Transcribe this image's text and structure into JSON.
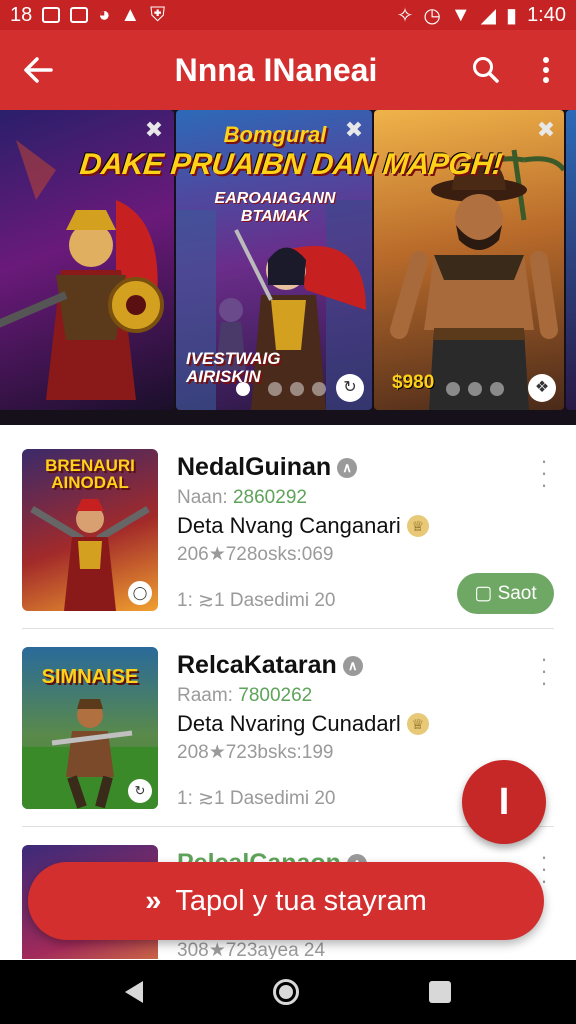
{
  "status_bar": {
    "time_left": "18",
    "clock": "1:40"
  },
  "app_bar": {
    "title": "Nnna INaneai"
  },
  "carousel": {
    "banner_superhead": "Bomgural",
    "headline": "DAKE PRUAIBN DAN MAPGH!",
    "subhead": "EAROAIAGANN BTAMAK",
    "tag": "IVESTWAIG\nAIRISKIN",
    "price": "$980",
    "page_indicator": {
      "current": 1,
      "total": 4
    }
  },
  "games": [
    {
      "name": "NedalGuinan",
      "thumb_label": "BRENAURI AINODAL",
      "id_label": "Naan:",
      "id_value": "2860292",
      "subtitle": "Deta Nvang Canganari",
      "stats": "206★728osks:069",
      "info": "1: ≳1 Dasedimi 20",
      "action_label": "Saot",
      "thumb_colors": [
        "#3a2a6a",
        "#a22a2a",
        "#f0a030"
      ]
    },
    {
      "name": "RelcaKataran",
      "thumb_label": "SIMNAISE",
      "id_label": "Raam:",
      "id_value": "7800262",
      "subtitle": "Deta Nvaring Cunadarl",
      "stats": "208★723bsks:199",
      "info": "1: ≳1 Dasedimi 20",
      "action_label": "",
      "thumb_colors": [
        "#2a6a9a",
        "#3a7a2a",
        "#c88a3a"
      ]
    },
    {
      "name": "PelcalCanaon",
      "thumb_label": "",
      "id_label": "",
      "id_value": "",
      "subtitle": "",
      "stats": "308★723ayea 24",
      "info": "",
      "action_label": "",
      "thumb_colors": [
        "#3a2a7a",
        "#a22a5a",
        "#f0a030"
      ]
    }
  ],
  "fab": {
    "label": "I"
  },
  "cta": {
    "chevron": "»",
    "label": "Tapol y tua stayram"
  },
  "colors": {
    "primary": "#d32f2f",
    "status_bar": "#c62424",
    "save_green": "#6fa764",
    "nav_bar": "#000000"
  }
}
